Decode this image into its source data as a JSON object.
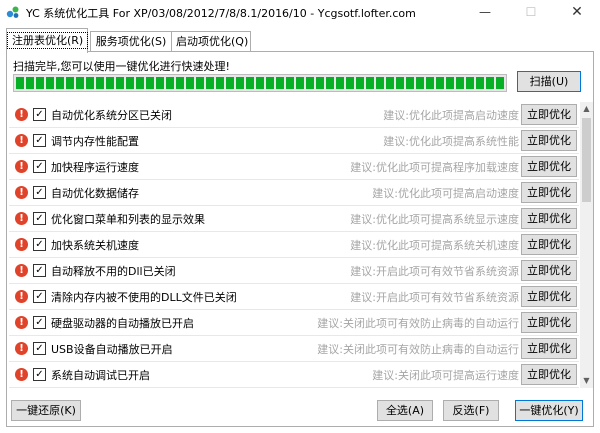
{
  "window": {
    "title": "YC 系统优化工具 For XP/03/08/2012/7/8/8.1/2016/10 - Ycgsotf.lofter.com",
    "minimize": "—",
    "maximize": "☐",
    "close": "✕"
  },
  "tabs": [
    {
      "label": "注册表优化(R)"
    },
    {
      "label": "服务项优化(S)"
    },
    {
      "label": "启动项优化(Q)"
    }
  ],
  "scan": {
    "status": "扫描完毕,您可以使用一键优化进行快速处理!",
    "progress_percent": 100,
    "button": "扫描(U)"
  },
  "items": [
    {
      "label": "自动优化系统分区已关闭",
      "hint": "建议:优化此项提高启动速度",
      "checked": true,
      "button": "立即优化"
    },
    {
      "label": "调节内存性能配置",
      "hint": "建议:优化此项提高系统性能",
      "checked": true,
      "button": "立即优化"
    },
    {
      "label": "加快程序运行速度",
      "hint": "建议:优化此项可提高程序加载速度",
      "checked": true,
      "button": "立即优化"
    },
    {
      "label": "自动优化数据储存",
      "hint": "建议:优化此项可提高启动速度",
      "checked": true,
      "button": "立即优化"
    },
    {
      "label": "优化窗口菜单和列表的显示效果",
      "hint": "建议:优化此项可提高系统显示速度",
      "checked": true,
      "button": "立即优化"
    },
    {
      "label": "加快系统关机速度",
      "hint": "建议:优化此项可提高系统关机速度",
      "checked": true,
      "button": "立即优化"
    },
    {
      "label": "自动释放不用的Dll已关闭",
      "hint": "建议:开启此项可有效节省系统资源",
      "checked": true,
      "button": "立即优化"
    },
    {
      "label": "清除内存内被不使用的DLL文件已关闭",
      "hint": "建议:开启此项可有效节省系统资源",
      "checked": true,
      "button": "立即优化"
    },
    {
      "label": "硬盘驱动器的自动播放已开启",
      "hint": "建议:关闭此项可有效防止病毒的自动运行",
      "checked": true,
      "button": "立即优化"
    },
    {
      "label": "USB设备自动播放已开启",
      "hint": "建议:关闭此项可有效防止病毒的自动运行",
      "checked": true,
      "button": "立即优化"
    },
    {
      "label": "系统自动调试已开启",
      "hint": "建议:关闭此项可提高运行速度",
      "checked": true,
      "button": "立即优化"
    }
  ],
  "footer": {
    "restore": "一键还原(K)",
    "select_all": "全选(A)",
    "invert": "反选(F)",
    "optimize_all": "一键优化(Y)"
  },
  "colors": {
    "progress": "#06b025",
    "warning": "#e0432a",
    "hint": "#a5a5a5",
    "focus": "#0078d7"
  }
}
